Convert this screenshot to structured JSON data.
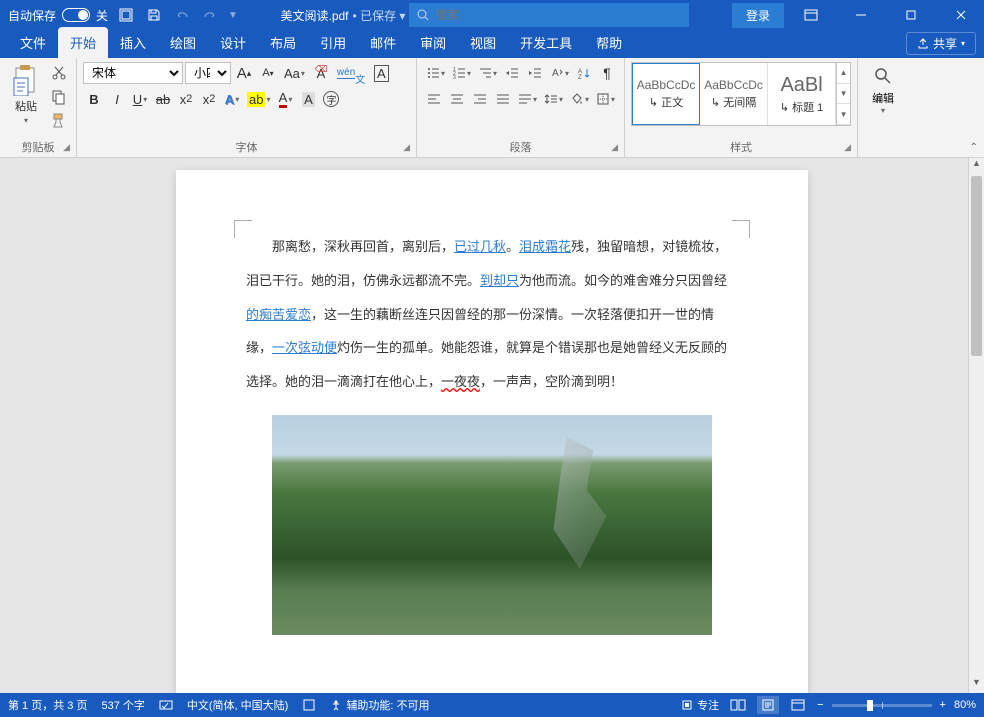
{
  "titlebar": {
    "autosave_label": "自动保存",
    "autosave_state": "关",
    "doc_name": "美文阅读.pdf",
    "saved_label": "已保存",
    "search_placeholder": "搜索",
    "login": "登录"
  },
  "tabs": {
    "items": [
      "文件",
      "开始",
      "插入",
      "绘图",
      "设计",
      "布局",
      "引用",
      "邮件",
      "审阅",
      "视图",
      "开发工具",
      "帮助"
    ],
    "active_index": 1,
    "share": "共享"
  },
  "ribbon": {
    "clipboard": {
      "paste": "粘贴",
      "label": "剪贴板"
    },
    "font": {
      "family": "宋体",
      "size": "小四",
      "label": "字体"
    },
    "paragraph": {
      "label": "段落"
    },
    "styles": {
      "label": "样式",
      "items": [
        {
          "preview": "AaBbCcDc",
          "name": "正文",
          "active": true
        },
        {
          "preview": "AaBbCcDc",
          "name": "无间隔",
          "active": false
        },
        {
          "preview": "AaBl",
          "name": "标题 1",
          "active": false
        }
      ]
    },
    "editing": {
      "label": "编辑"
    }
  },
  "document": {
    "paragraphs": [
      {
        "segments": [
          {
            "t": "那离愁，深秋再回首，离别后，",
            "c": ""
          },
          {
            "t": "已过几秋",
            "c": "hl"
          },
          {
            "t": "。",
            "c": ""
          },
          {
            "t": "泪成霜花",
            "c": "hl"
          },
          {
            "t": "残，独留暗想，对镜梳妆，泪已干行。她的泪，仿佛永远都流不完。",
            "c": ""
          },
          {
            "t": "到却只",
            "c": "hl"
          },
          {
            "t": "为他而流。如今的难舍难分只因曾经",
            "c": ""
          },
          {
            "t": "的痴苦爱恋",
            "c": "hl"
          },
          {
            "t": "，这一生的藕断丝连只因曾经的那一份深情。一次轻落便扣开一世的情缘，",
            "c": ""
          },
          {
            "t": "一次弦动便",
            "c": "hl"
          },
          {
            "t": "灼伤一生的孤单。她能怨谁，就算是个错误那也是她曾经义无反顾的选择。她的泪一滴滴打在他心上，",
            "c": ""
          },
          {
            "t": "一夜夜",
            "c": "wavy"
          },
          {
            "t": "，一声声，空阶滴到明！",
            "c": ""
          }
        ]
      }
    ]
  },
  "statusbar": {
    "page": "第 1 页，共 3 页",
    "words": "537 个字",
    "language": "中文(简体, 中国大陆)",
    "accessibility": "辅助功能: 不可用",
    "focus": "专注",
    "zoom": "80%"
  }
}
